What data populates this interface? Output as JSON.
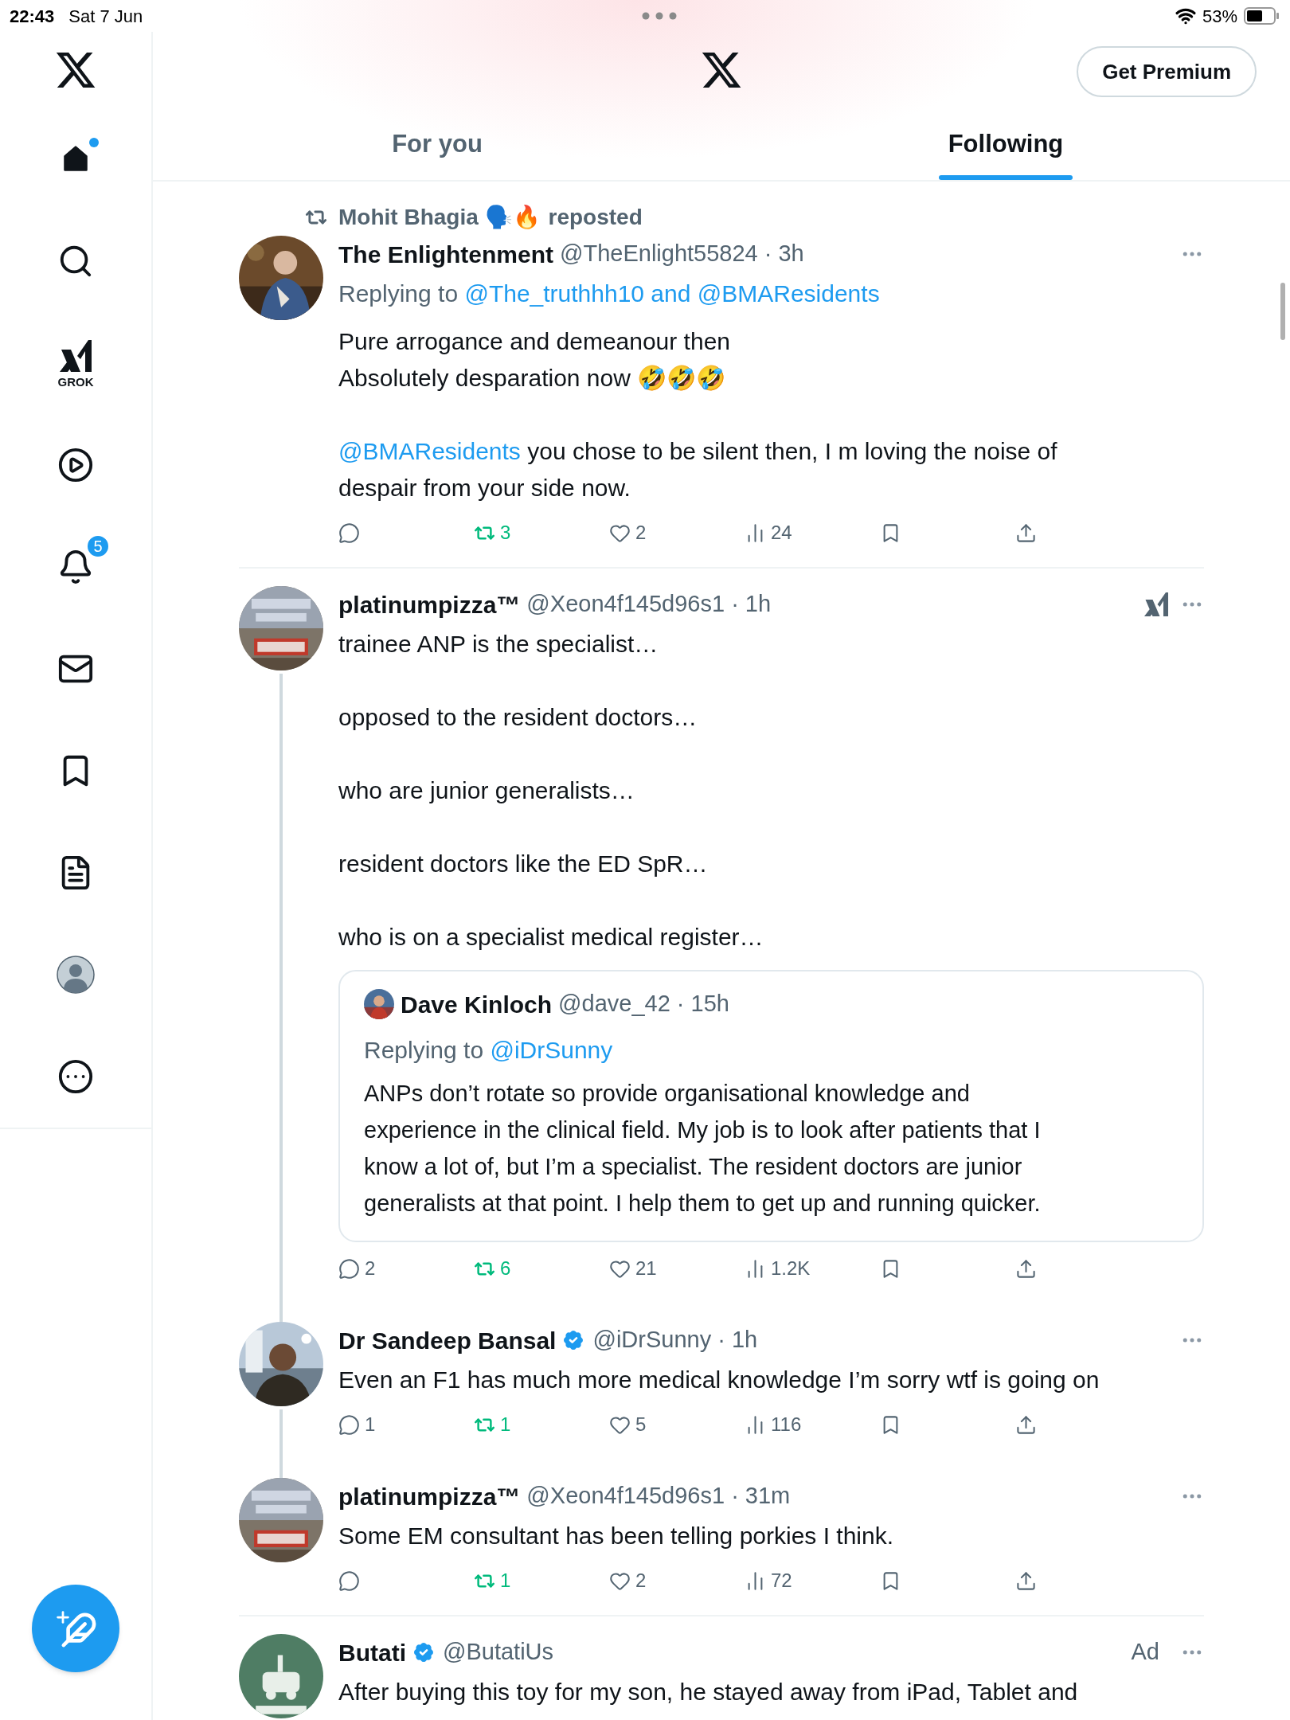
{
  "status_bar": {
    "time": "22:43",
    "date": "Sat 7 Jun",
    "battery": "53%"
  },
  "sidebar": {
    "items": [
      {
        "kind": "home",
        "selected": true,
        "unread": true
      },
      {
        "kind": "search",
        "selected": false,
        "unread": false
      },
      {
        "kind": "grok",
        "label": "GROK",
        "selected": false,
        "unread": false
      },
      {
        "kind": "video",
        "selected": false,
        "unread": false
      },
      {
        "kind": "notifications",
        "badge": "5",
        "selected": false,
        "unread": false
      },
      {
        "kind": "messages",
        "selected": false,
        "unread": false
      },
      {
        "kind": "bookmarks",
        "selected": false,
        "unread": false
      },
      {
        "kind": "lists",
        "selected": false,
        "unread": false
      },
      {
        "kind": "profile",
        "selected": false,
        "unread": false
      },
      {
        "kind": "more",
        "selected": false,
        "unread": false
      }
    ]
  },
  "header": {
    "premium_button": "Get Premium"
  },
  "tabs": [
    {
      "label": "For you",
      "selected": false
    },
    {
      "label": "Following",
      "selected": true
    }
  ],
  "posts": [
    {
      "repost_by": {
        "name": "Mohit Bhagia 🗣️🔥",
        "label": "reposted"
      },
      "name": "The Enlightenment",
      "verified": false,
      "handle_time": "@TheEnlight55824 · 3h",
      "grok": false,
      "thread_line": false,
      "divider": true,
      "replying_to": {
        "label": "Replying to",
        "mentions": "@The_truthhh10 and @BMAResidents"
      },
      "body": [
        [
          {
            "kind": "text",
            "text": "Pure arrogance and demeanour then\nAbsolutely desparation now 🤣🤣🤣"
          }
        ],
        [
          {
            "kind": "mention",
            "text": "@BMAResidents"
          },
          {
            "kind": "text",
            "text": " you chose to be silent then, I m loving the noise of despair from your side now."
          }
        ]
      ],
      "actions": [
        {
          "kind": "reply",
          "active": false
        },
        {
          "kind": "repost",
          "count": "3",
          "active": true
        },
        {
          "kind": "like",
          "count": "2",
          "active": false
        },
        {
          "kind": "views",
          "count": "24",
          "active": false
        },
        {
          "kind": "bookmark",
          "active": false
        },
        {
          "kind": "share",
          "active": false
        }
      ]
    },
    {
      "name": "platinumpizza™",
      "verified": false,
      "handle_time": "@Xeon4f145d96s1 · 1h",
      "grok": true,
      "thread_line": true,
      "divider": false,
      "body": [
        [
          {
            "kind": "text",
            "text": "trainee ANP is the specialist…"
          }
        ],
        [
          {
            "kind": "text",
            "text": "opposed to the resident doctors…"
          }
        ],
        [
          {
            "kind": "text",
            "text": "who are junior generalists…"
          }
        ],
        [
          {
            "kind": "text",
            "text": "resident doctors like the ED SpR…"
          }
        ],
        [
          {
            "kind": "text",
            "text": "who is on a specialist medical register…"
          }
        ]
      ],
      "quote": {
        "name": "Dave Kinloch",
        "handle_time": "@dave_42 · 15h",
        "replying_to": {
          "label": "Replying to",
          "mentions": "@iDrSunny"
        },
        "text": "ANPs don’t rotate so provide organisational knowledge and experience in the clinical field. My job is to look after patients that I know a lot of, but I’m a specialist. The resident doctors are junior generalists at that point. I help them to get up and running quicker."
      },
      "actions": [
        {
          "kind": "reply",
          "count": "2",
          "active": false
        },
        {
          "kind": "repost",
          "count": "6",
          "active": true
        },
        {
          "kind": "like",
          "count": "21",
          "active": false
        },
        {
          "kind": "views",
          "count": "1.2K",
          "active": false
        },
        {
          "kind": "bookmark",
          "active": false
        },
        {
          "kind": "share",
          "active": false
        }
      ]
    },
    {
      "name": "Dr Sandeep Bansal",
      "verified": true,
      "handle_time": "@iDrSunny · 1h",
      "grok": false,
      "thread_line": true,
      "divider": false,
      "body": [
        [
          {
            "kind": "text",
            "text": "Even an F1 has much more medical knowledge I’m sorry wtf is going on"
          }
        ]
      ],
      "actions": [
        {
          "kind": "reply",
          "count": "1",
          "active": false
        },
        {
          "kind": "repost",
          "count": "1",
          "active": true
        },
        {
          "kind": "like",
          "count": "5",
          "active": false
        },
        {
          "kind": "views",
          "count": "116",
          "active": false
        },
        {
          "kind": "bookmark",
          "active": false
        },
        {
          "kind": "share",
          "active": false
        }
      ]
    },
    {
      "name": "platinumpizza™",
      "verified": false,
      "handle_time": "@Xeon4f145d96s1 · 31m",
      "grok": false,
      "thread_line": false,
      "divider": true,
      "body": [
        [
          {
            "kind": "text",
            "text": "Some EM consultant has been telling porkies I think."
          }
        ]
      ],
      "actions": [
        {
          "kind": "reply",
          "active": false
        },
        {
          "kind": "repost",
          "count": "1",
          "active": true
        },
        {
          "kind": "like",
          "count": "2",
          "active": false
        },
        {
          "kind": "views",
          "count": "72",
          "active": false
        },
        {
          "kind": "bookmark",
          "active": false
        },
        {
          "kind": "share",
          "active": false
        }
      ]
    },
    {
      "name": "Butati",
      "verified": true,
      "handle_time": "@ButatiUs",
      "ad": "Ad",
      "grok": false,
      "thread_line": false,
      "divider": false,
      "body": [
        [
          {
            "kind": "text",
            "text": "After buying this toy for my son, he stayed away from iPad, Tablet and"
          }
        ]
      ]
    }
  ]
}
